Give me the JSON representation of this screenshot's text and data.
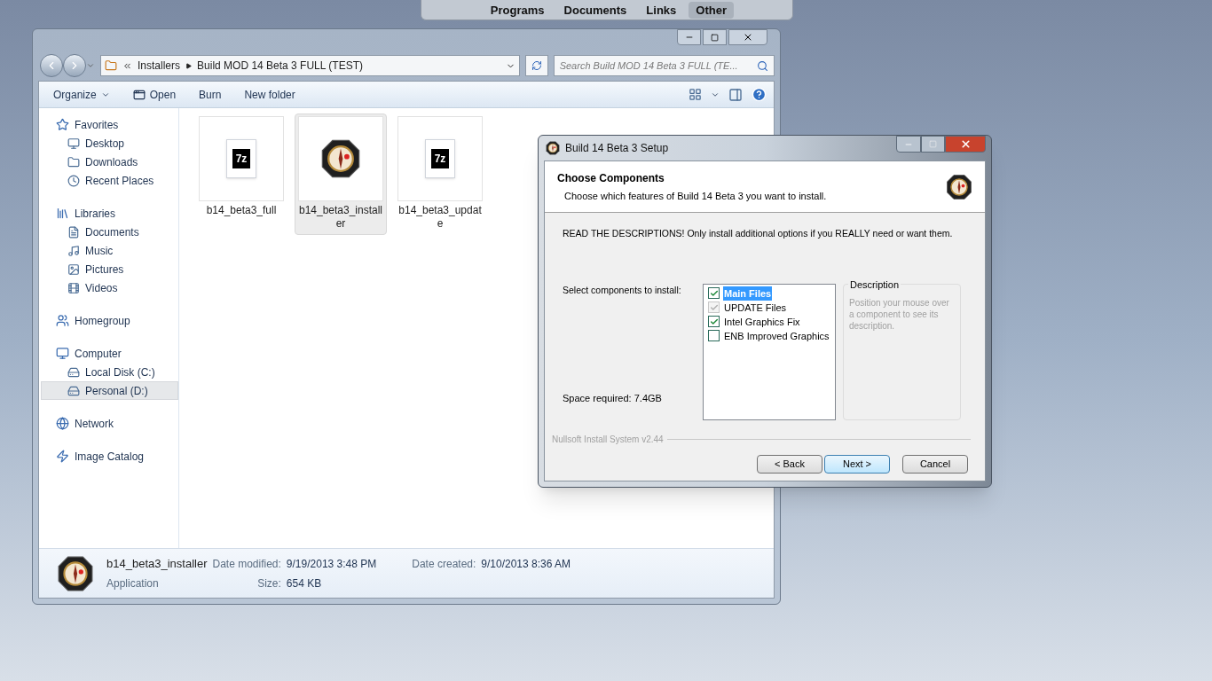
{
  "top_bar": {
    "items": [
      {
        "label": "Programs",
        "selected": false
      },
      {
        "label": "Documents",
        "selected": false
      },
      {
        "label": "Links",
        "selected": false
      },
      {
        "label": "Other",
        "selected": true
      }
    ]
  },
  "explorer": {
    "address": {
      "crumbs": [
        "Installers",
        "Build MOD 14 Beta 3 FULL (TEST)"
      ]
    },
    "search": {
      "placeholder": "Search Build MOD 14 Beta 3 FULL (TE..."
    },
    "toolbar": [
      {
        "label": "Organize",
        "kind": "menu"
      },
      {
        "label": "Open",
        "kind": "icon"
      },
      {
        "label": "Burn",
        "kind": "plain"
      },
      {
        "label": "New folder",
        "kind": "plain"
      }
    ],
    "sidebar": [
      {
        "label": "Favorites",
        "children": [
          {
            "label": "Desktop",
            "selected": false
          },
          {
            "label": "Downloads",
            "selected": false
          },
          {
            "label": "Recent Places",
            "selected": false
          }
        ]
      },
      {
        "label": "Libraries",
        "children": [
          {
            "label": "Documents",
            "selected": false
          },
          {
            "label": "Music",
            "selected": false
          },
          {
            "label": "Pictures",
            "selected": false
          },
          {
            "label": "Videos",
            "selected": false
          }
        ]
      },
      {
        "label": "Homegroup"
      },
      {
        "label": "Computer",
        "children": [
          {
            "label": "Local Disk (C:)",
            "selected": false
          },
          {
            "label": "Personal (D:)",
            "selected": true
          }
        ]
      },
      {
        "label": "Network"
      },
      {
        "label": "Image Catalog"
      }
    ],
    "files": [
      {
        "name": "b14_beta3_full",
        "kind": "archive",
        "icon_text": "7z",
        "selected": false
      },
      {
        "name": "b14_beta3_installer",
        "kind": "application",
        "selected": true
      },
      {
        "name": "b14_beta3_update",
        "kind": "archive",
        "icon_text": "7z",
        "selected": false
      }
    ],
    "details": {
      "name": "b14_beta3_installer",
      "type": "Application",
      "fields": [
        {
          "label": "Date modified:",
          "value": "9/19/2013 3:48 PM"
        },
        {
          "label": "Size:",
          "value": "654 KB"
        },
        {
          "label": "Date created:",
          "value": "9/10/2013 8:36 AM"
        }
      ]
    }
  },
  "setup": {
    "title": "Build 14 Beta 3 Setup",
    "header": "Choose Components",
    "subtitle": "Choose which features of Build 14 Beta 3 you want to install.",
    "instruction": "READ THE DESCRIPTIONS! Only install additional options if you REALLY need or want them.",
    "select_label": "Select components to install:",
    "components": [
      {
        "label": "Main Files",
        "checked": true,
        "disabled": false,
        "selected": true
      },
      {
        "label": "UPDATE Files",
        "checked": true,
        "disabled": true,
        "selected": false
      },
      {
        "label": "Intel Graphics Fix",
        "checked": true,
        "disabled": false,
        "selected": false
      },
      {
        "label": "ENB Improved Graphics",
        "checked": false,
        "disabled": false,
        "selected": false
      }
    ],
    "description": {
      "legend": "Description",
      "text": "Position your mouse over a component to see its description."
    },
    "space": "Space required: 7.4GB",
    "branding": "Nullsoft Install System v2.44",
    "buttons": [
      {
        "label": "< Back",
        "default": false
      },
      {
        "label": "Next >",
        "default": true
      },
      {
        "label": "Cancel",
        "default": false
      }
    ]
  }
}
